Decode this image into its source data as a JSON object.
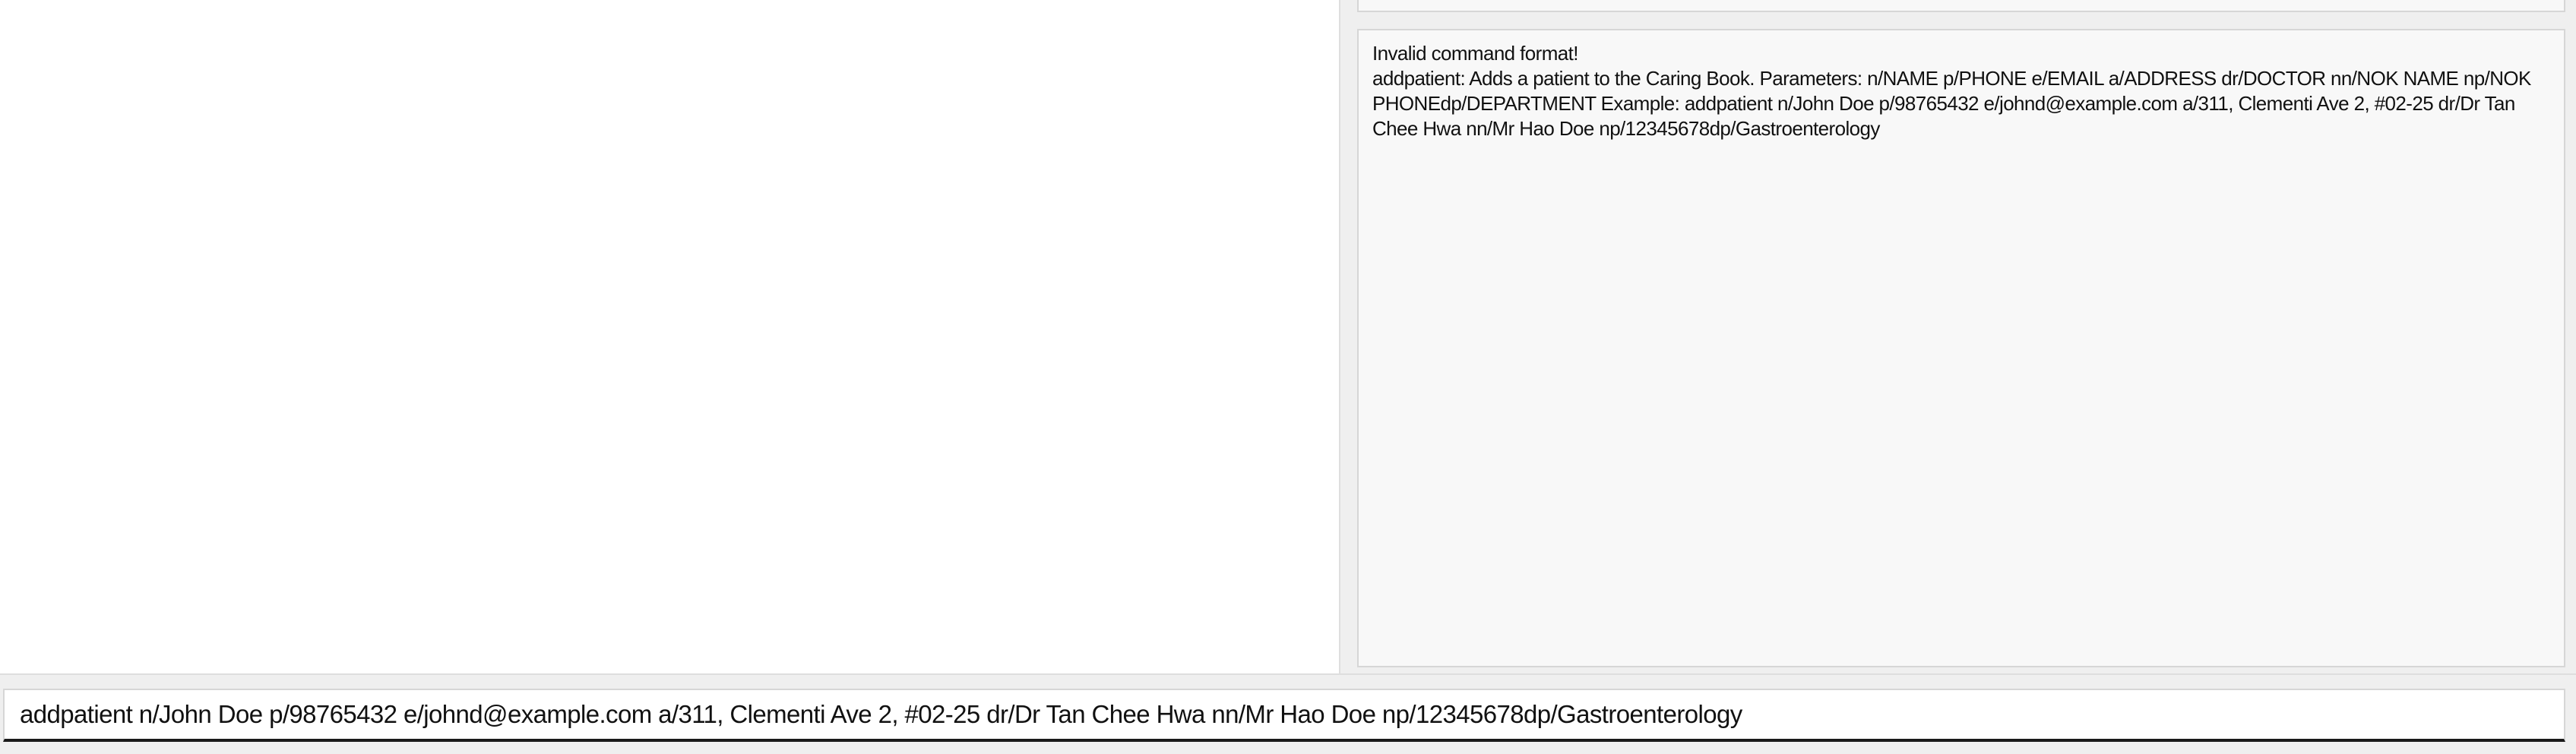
{
  "result_display": {
    "line1": "Invalid command format!",
    "line2": "addpatient: Adds a patient to the Caring Book. Parameters: n/NAME p/PHONE e/EMAIL a/ADDRESS dr/DOCTOR nn/NOK NAME np/NOK PHONEdp/DEPARTMENT Example: addpatient n/John Doe p/98765432 e/johnd@example.com a/311, Clementi Ave 2, #02-25 dr/Dr Tan Chee Hwa nn/Mr Hao Doe np/12345678dp/Gastroenterology"
  },
  "command_box": {
    "value": "addpatient n/John Doe p/98765432 e/johnd@example.com a/311, Clementi Ave 2, #02-25 dr/Dr Tan Chee Hwa nn/Mr Hao Doe np/12345678dp/Gastroenterology"
  },
  "colors": {
    "background": "#ffffff",
    "panel_background": "#efefef",
    "box_background": "#f8f8f8",
    "border": "#d6d6d6",
    "text": "#111111"
  }
}
